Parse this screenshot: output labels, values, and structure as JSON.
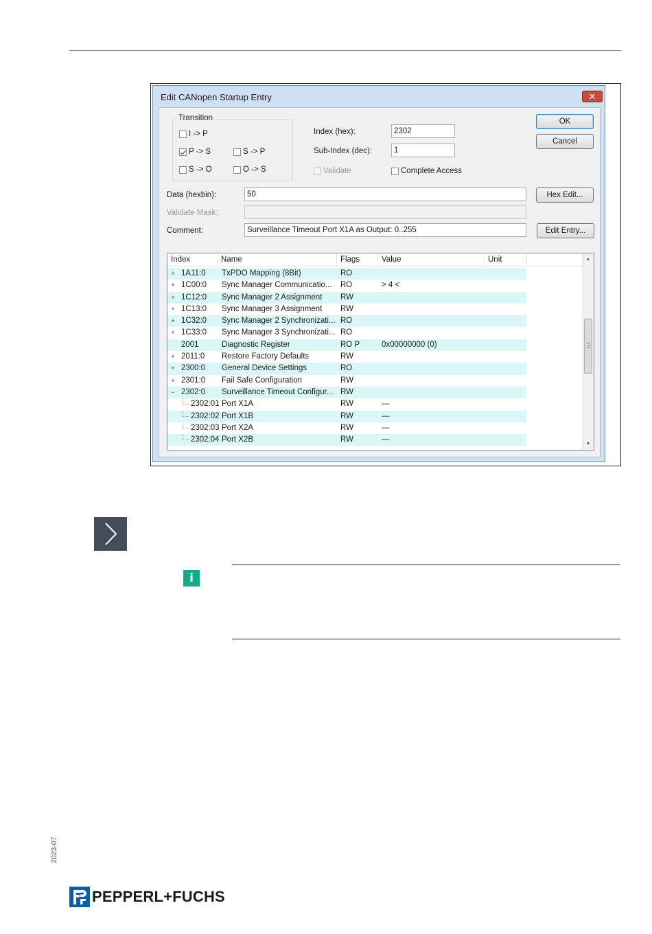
{
  "dialog": {
    "title": "Edit CANopen Startup Entry",
    "close_glyph": "✕",
    "transition": {
      "label": "Transition",
      "options": [
        {
          "label": "I -> P",
          "checked": false
        },
        {
          "label": "P -> S",
          "checked": true
        },
        {
          "label": "S -> P",
          "checked": false
        },
        {
          "label": "S -> O",
          "checked": false
        },
        {
          "label": "O -> S",
          "checked": false
        }
      ]
    },
    "index_hex": {
      "label": "Index (hex):",
      "value": "2302"
    },
    "sub_index": {
      "label": "Sub-Index (dec):",
      "value": "1"
    },
    "validate": {
      "label": "Validate",
      "checked": false,
      "enabled": false
    },
    "complete_access": {
      "label": "Complete Access",
      "checked": false
    },
    "data": {
      "label": "Data (hexbin):",
      "value": "50"
    },
    "validate_mask": {
      "label": "Validate Mask:",
      "value": ""
    },
    "comment": {
      "label": "Comment:",
      "value": "Surveillance Timeout Port X1A as Output: 0..255"
    },
    "buttons": {
      "ok": "OK",
      "cancel": "Cancel",
      "hex_edit": "Hex Edit...",
      "edit_entry": "Edit Entry..."
    },
    "grid": {
      "columns": [
        "Index",
        "Name",
        "Flags",
        "Value",
        "Unit"
      ],
      "rows": [
        {
          "expander": "+",
          "index": "1A11:0",
          "name": "TxPDO Mapping (8Bit)",
          "flags": "RO",
          "value": ""
        },
        {
          "expander": "+",
          "index": "1C00:0",
          "name": "Sync Manager Communicatio...",
          "flags": "RO",
          "value": "> 4 <"
        },
        {
          "expander": "+",
          "index": "1C12:0",
          "name": "Sync Manager 2 Assignment",
          "flags": "RW",
          "value": ""
        },
        {
          "expander": "+",
          "index": "1C13:0",
          "name": "Sync Manager 3 Assignment",
          "flags": "RW",
          "value": ""
        },
        {
          "expander": "+",
          "index": "1C32:0",
          "name": "Sync Manager 2 Synchronizati...",
          "flags": "RO",
          "value": ""
        },
        {
          "expander": "+",
          "index": "1C33:0",
          "name": "Sync Manager 3 Synchronizati...",
          "flags": "RO",
          "value": ""
        },
        {
          "expander": "",
          "index": "2001",
          "name": "Diagnostic Register",
          "flags": "RO P",
          "value": "0x00000000 (0)"
        },
        {
          "expander": "+",
          "index": "2011:0",
          "name": "Restore Factory Defaults",
          "flags": "RW",
          "value": ""
        },
        {
          "expander": "+",
          "index": "2300:0",
          "name": "General Device Settings",
          "flags": "RO",
          "value": ""
        },
        {
          "expander": "+",
          "index": "2301:0",
          "name": "Fail Safe Configuration",
          "flags": "RW",
          "value": ""
        },
        {
          "expander": "−",
          "index": "2302:0",
          "name": "Surveillance Timeout Configur...",
          "flags": "RW",
          "value": ""
        },
        {
          "expander": "",
          "child": true,
          "index": "2302:01",
          "name": "Port X1A",
          "flags": "RW",
          "value": "—"
        },
        {
          "expander": "",
          "child": true,
          "index": "2302:02",
          "name": "Port X1B",
          "flags": "RW",
          "value": "—"
        },
        {
          "expander": "",
          "child": true,
          "index": "2302:03",
          "name": "Port X2A",
          "flags": "RW",
          "value": "—"
        },
        {
          "expander": "",
          "child": true,
          "index": "2302:04",
          "name": "Port X2B",
          "flags": "RW",
          "value": "—"
        }
      ]
    }
  },
  "page": {
    "side_date": "2023-07",
    "logo_text": "PEPPERL+FUCHS",
    "info_glyph": "i",
    "colors": {
      "info": "#1aa889",
      "arrow_box": "#444c58",
      "logo_blue": "#0d5fa5"
    }
  }
}
